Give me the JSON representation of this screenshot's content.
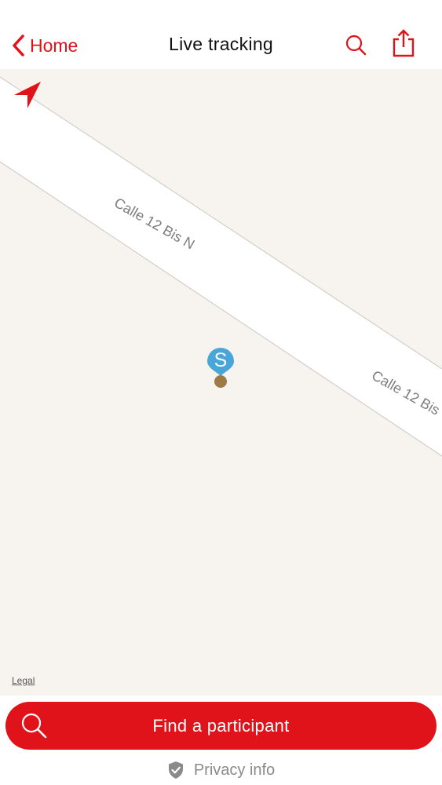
{
  "header": {
    "back_label": "Home",
    "title": "Live tracking",
    "search_icon": "search-icon",
    "share_icon": "share-icon"
  },
  "map": {
    "locate_icon": "location-arrow-icon",
    "streets": [
      "Calle 12 Bis N",
      "Calle 12 Bis"
    ],
    "marker_letter": "S",
    "legal_label": "Legal"
  },
  "footer": {
    "find_label": "Find a participant",
    "privacy_label": "Privacy info",
    "privacy_icon": "shield-check-icon"
  },
  "colors": {
    "accent": "#e0121a",
    "map_background": "#f7f4ef",
    "road": "#ffffff",
    "marker": "#4aa6d9",
    "marker_dot": "#a07a45"
  }
}
